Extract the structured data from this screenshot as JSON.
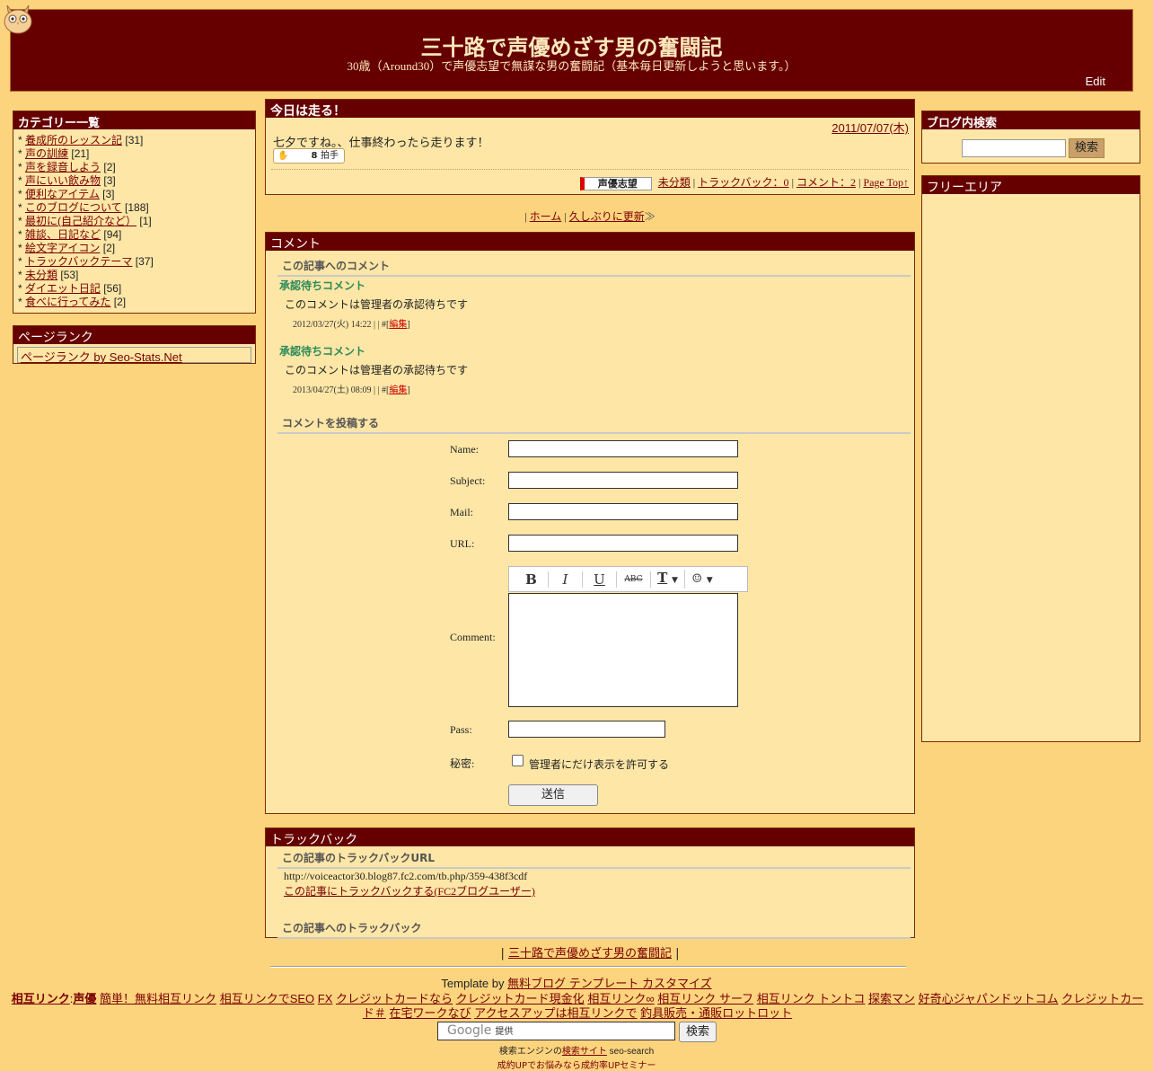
{
  "header": {
    "title": "三十路で声優めざす男の奮闘記",
    "description": "30歳（Around30）で声優志望で無謀な男の奮闘記（基本毎日更新しようと思います。）",
    "edit": "Edit"
  },
  "sidebar_left": {
    "categories_title": "カテゴリー一覧",
    "categories": [
      {
        "name": "養成所のレッスン記",
        "count": "[31]"
      },
      {
        "name": "声の訓練",
        "count": "[21]"
      },
      {
        "name": "声を録音しよう",
        "count": "[2]"
      },
      {
        "name": "声にいい飲み物",
        "count": "[3]"
      },
      {
        "name": "便利なアイテム",
        "count": "[3]"
      },
      {
        "name": "このブログについて",
        "count": "[188]"
      },
      {
        "name": "最初に(自己紹介など）",
        "count": "[1]"
      },
      {
        "name": "雑談、日記など",
        "count": "[94]"
      },
      {
        "name": "絵文字アイコン",
        "count": "[2]"
      },
      {
        "name": "トラックバックテーマ",
        "count": "[37]"
      },
      {
        "name": "未分類",
        "count": "[53]"
      },
      {
        "name": "ダイエット日記",
        "count": "[56]"
      },
      {
        "name": "食べに行ってみた",
        "count": "[2]"
      }
    ],
    "pagerank_title": "ページランク",
    "pagerank_link": "ページランク by Seo-Stats.Net"
  },
  "sidebar_right": {
    "search_title": "ブログ内検索",
    "search_button": "検索",
    "free_title": "フリーエリア"
  },
  "entry": {
    "title": "今日は走る！",
    "date": "2011/07/07(木)",
    "body": "七夕ですね。、仕事終わったら走ります！",
    "clap_label": "拍手",
    "clap_count": "8",
    "badge": "声優志望",
    "category": "未分類",
    "trackback": "トラックバック：0",
    "comment": "コメント：2",
    "pagetop": "Page Top↑"
  },
  "pager": {
    "home": "ホーム",
    "next": "久しぶりに更新"
  },
  "comments": {
    "title": "コメント",
    "list_heading": "この記事へのコメント",
    "items": [
      {
        "heading": "承認待ちコメント",
        "text": "このコメントは管理者の承認待ちです",
        "meta": "2012/03/27(火) 14:22 | | #[",
        "edit": "編集"
      },
      {
        "heading": "承認待ちコメント",
        "text": "このコメントは管理者の承認待ちです",
        "meta": "2013/04/27(土) 08:09 | | #[",
        "edit": "編集"
      }
    ],
    "form_heading": "コメントを投稿する",
    "form": {
      "name_label": "Name:",
      "subject_label": "Subject:",
      "mail_label": "Mail:",
      "url_label": "URL:",
      "comment_label": "Comment:",
      "pass_label": "Pass:",
      "secret_label": "秘密:",
      "secret_option": "管理者にだけ表示を許可する",
      "submit": "送信"
    }
  },
  "trackback": {
    "title": "トラックバック",
    "url_heading": "この記事のトラックバックURL",
    "url": "http://voiceactor30.blog87.fc2.com/tb.php/359-438f3cdf",
    "fc2_link": "この記事にトラックバックする(FC2ブログユーザー)",
    "list_heading": "この記事へのトラックバック"
  },
  "footer": {
    "blog_link": "三十路で声優めざす男の奮闘記",
    "template_prefix": "Template by",
    "template_link": "無料ブログ テンプレート カスタマイズ",
    "mutual_links": [
      "簡単！無料相互リンク",
      "相互リンクでSEO",
      "FX",
      "クレジットカードなら",
      "クレジットカード現金化",
      "相互リンク∞",
      "相互リンク サーフ",
      "相互リンク トントコ",
      "探索マン",
      "好奇心ジャパンドットコム",
      "クレジットカード＃",
      "在宅ワークなび",
      "アクセスアップは相互リンクで",
      "釣具販売・通販ロットロット"
    ],
    "mutual_prefix": "相互リンク",
    "mutual_prefix2": "声優",
    "google_provided": "提供",
    "google_word": "Google",
    "google_button": "検索",
    "seo_prefix": "検索エンジンの",
    "seo_link": "検索サイト",
    "seo_suffix": "seo-search",
    "seo_line2": "成約UPでお悩みなら成約率UPセミナー"
  },
  "colors": {
    "background": "#fdd47e",
    "header": "#660000",
    "panel": "#fde6a6",
    "link": "#7a0000",
    "pending": "#2c8a5a"
  }
}
